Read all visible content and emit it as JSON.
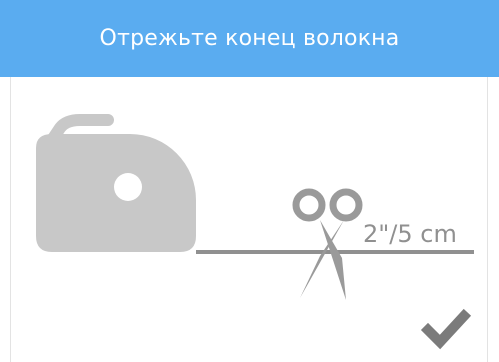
{
  "header": {
    "title": "Отрежьте конец волокна"
  },
  "illustration": {
    "filament_length_label": "2\"/5 cm",
    "spool_icon": "filament-spool-icon",
    "scissors_icon": "scissors-icon"
  },
  "actions": {
    "confirm_icon": "checkmark-icon"
  },
  "colors": {
    "header_background": "#5aacf0",
    "header_text": "#ffffff",
    "illustration_gray": "#c8c8c8",
    "line_gray": "#909090",
    "checkmark_gray": "#7b7b7b"
  }
}
